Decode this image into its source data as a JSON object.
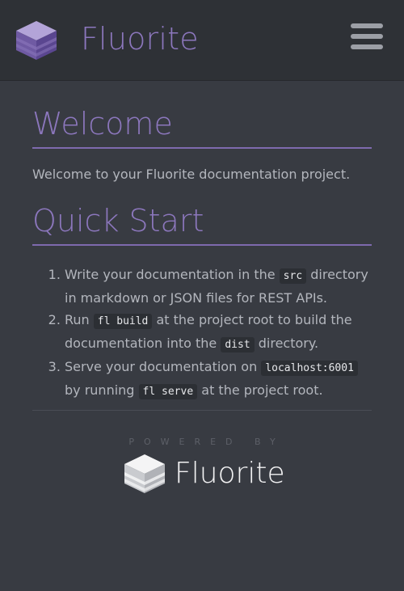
{
  "header": {
    "app_title": "Fluorite",
    "logo_icon": "fluorite-cube-icon",
    "menu_icon": "hamburger-menu-icon"
  },
  "welcome": {
    "heading": "Welcome",
    "text": "Welcome to your Fluorite documentation project."
  },
  "quick_start": {
    "heading": "Quick Start",
    "steps": [
      {
        "a": "Write your documentation in the ",
        "code1": "src",
        "b": " directory in markdown or JSON files for REST APIs."
      },
      {
        "a": "Run ",
        "code1": "fl build",
        "b": " at the project root to build the documentation into the ",
        "code2": "dist",
        "c": " directory."
      },
      {
        "a": "Serve your documentation on ",
        "code1": "localhost:6001",
        "b": " by running ",
        "code2": "fl serve",
        "c": " at the project root."
      }
    ]
  },
  "footer": {
    "powered_by": "POWERED BY",
    "brand": "Fluorite",
    "logo_icon": "fluorite-cube-white-icon"
  },
  "colors": {
    "accent": "#8c77bd",
    "background": "#383b42",
    "header": "#2e3136"
  }
}
